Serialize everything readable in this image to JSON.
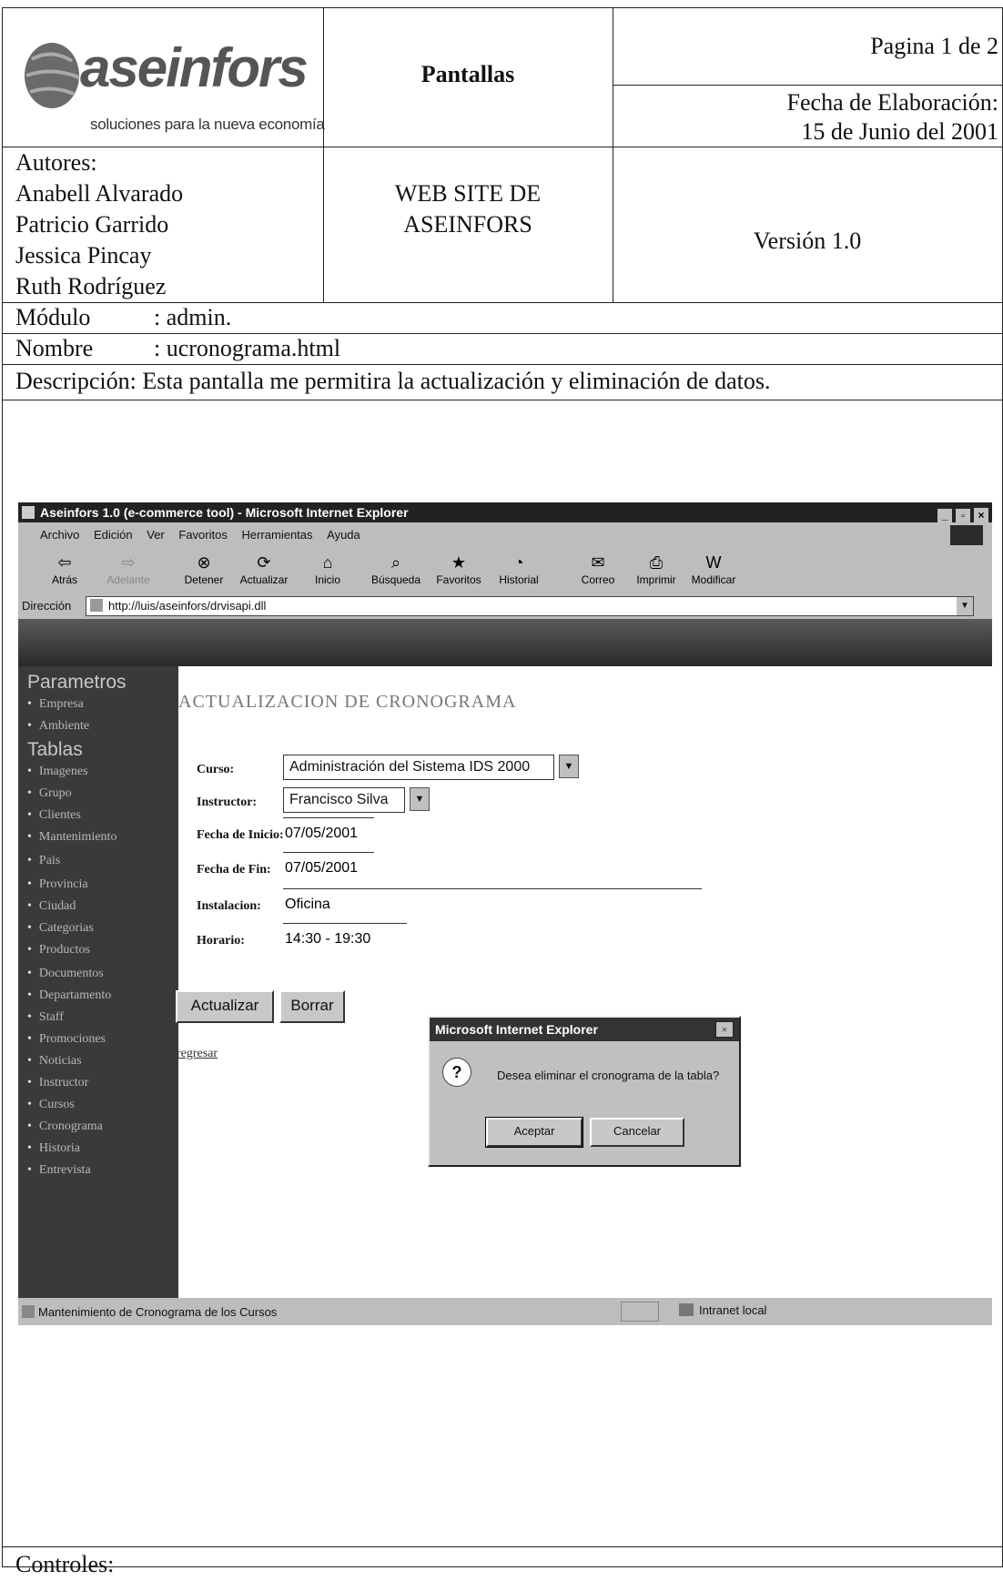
{
  "header": {
    "logo_word": "aseinfors",
    "logo_tagline": "soluciones para la nueva economía",
    "doc_type": "Pantallas",
    "page": "Pagina 1 de 2",
    "date_label": "Fecha de Elaboración:",
    "date_value": "15 de Junio del 2001"
  },
  "authors": {
    "label": "Autores:",
    "names": [
      "Anabell Alvarado",
      "Patricio Garrido",
      "Jessica Pincay",
      "Ruth Rodríguez"
    ]
  },
  "project": {
    "line1": "WEB SITE DE",
    "line2": "ASEINFORS",
    "version": "Versión 1.0"
  },
  "meta": {
    "module_label": "Módulo",
    "module_value": ": admin.",
    "name_label": "Nombre",
    "name_value": ": ucronograma.html",
    "description": "Descripción: Esta pantalla me permitira la actualización y eliminación de datos."
  },
  "browser": {
    "title": "Aseinfors 1.0 (e-commerce tool) - Microsoft Internet Explorer",
    "menu": [
      "Archivo",
      "Edición",
      "Ver",
      "Favoritos",
      "Herramientas",
      "Ayuda"
    ],
    "toolbar": [
      {
        "label": "Atrás",
        "icon": "back-arrow-icon",
        "glyph": "⇦"
      },
      {
        "label": "Adelante",
        "icon": "forward-arrow-icon",
        "glyph": "⇨"
      },
      {
        "label": "Detener",
        "icon": "stop-icon",
        "glyph": "⊗"
      },
      {
        "label": "Actualizar",
        "icon": "refresh-icon",
        "glyph": "⟳"
      },
      {
        "label": "Inicio",
        "icon": "home-icon",
        "glyph": "⌂"
      },
      {
        "label": "Búsqueda",
        "icon": "search-icon",
        "glyph": "⌕"
      },
      {
        "label": "Favoritos",
        "icon": "favorites-icon",
        "glyph": "★"
      },
      {
        "label": "Historial",
        "icon": "history-icon",
        "glyph": "◔"
      },
      {
        "label": "Correo",
        "icon": "mail-icon",
        "glyph": "✉"
      },
      {
        "label": "Imprimir",
        "icon": "print-icon",
        "glyph": "⎙"
      },
      {
        "label": "Modificar",
        "icon": "edit-icon",
        "glyph": "W"
      }
    ],
    "address_label": "Dirección",
    "address_value": "http://luis/aseinfors/drvisapi.dll",
    "status_text": "Mantenimiento de Cronograma de los Cursos",
    "zone_text": "Intranet local"
  },
  "sidebar": {
    "section1": "Parametros",
    "items1": [
      "Empresa",
      "Ambiente"
    ],
    "section2": "Tablas",
    "items2": [
      "Imagenes",
      "Grupo",
      "Clientes",
      "Mantenimiento",
      "Pais",
      "Provincia",
      "Ciudad",
      "Categorias",
      "Productos",
      "Documentos",
      "Departamento",
      "Staff",
      "Promociones",
      "Noticias",
      "Instructor",
      "Cursos",
      "Cronograma",
      "Historia",
      "Entrevista"
    ]
  },
  "form": {
    "title": "ACTUALIZACION DE CRONOGRAMA",
    "curso_label": "Curso:",
    "curso_value": "Administración del Sistema IDS 2000",
    "instructor_label": "Instructor:",
    "instructor_value": "Francisco Silva",
    "fecha_inicio_label": "Fecha de Inicio:",
    "fecha_inicio_value": "07/05/2001",
    "fecha_fin_label": "Fecha de Fin:",
    "fecha_fin_value": "07/05/2001",
    "instalacion_label": "Instalacion:",
    "instalacion_value": "Oficina",
    "horario_label": "Horario:",
    "horario_value": "14:30 - 19:30",
    "update_button": "Actualizar",
    "delete_button": "Borrar",
    "back_link": "regresar"
  },
  "dialog": {
    "title": "Microsoft Internet Explorer",
    "message": "Desea eliminar el cronograma de la tabla?",
    "ok": "Aceptar",
    "cancel": "Cancelar"
  },
  "footer": {
    "controls_label": "Controles:"
  }
}
